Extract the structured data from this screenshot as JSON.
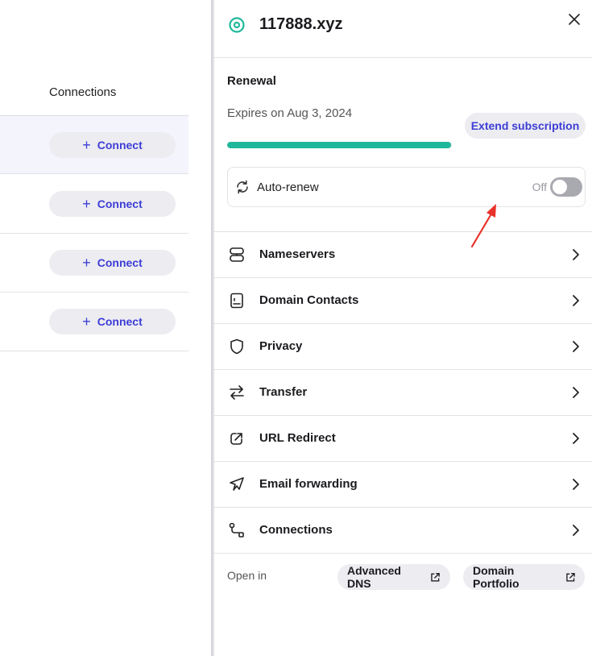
{
  "left_panel": {
    "column_header": "Connections",
    "rows": [
      {
        "connect_label": "Connect"
      },
      {
        "connect_label": "Connect"
      },
      {
        "connect_label": "Connect"
      },
      {
        "connect_label": "Connect"
      }
    ]
  },
  "drawer": {
    "domain": "117888.xyz",
    "renewal": {
      "title": "Renewal",
      "expires_text": "Expires on Aug 3, 2024",
      "extend_label": "Extend subscription",
      "progress_fraction": 0.995,
      "auto_renew_label": "Auto-renew",
      "auto_renew_state": "Off"
    },
    "menu": [
      {
        "label": "Nameservers",
        "icon": "server-icon"
      },
      {
        "label": "Domain Contacts",
        "icon": "contact-book-icon"
      },
      {
        "label": "Privacy",
        "icon": "shield-icon"
      },
      {
        "label": "Transfer",
        "icon": "transfer-arrows-icon"
      },
      {
        "label": "URL Redirect",
        "icon": "redirect-link-icon"
      },
      {
        "label": "Email forwarding",
        "icon": "email-forward-icon"
      },
      {
        "label": "Connections",
        "icon": "connections-icon"
      }
    ],
    "open_in": {
      "label": "Open in",
      "advanced_dns": "Advanced DNS",
      "domain_portfolio": "Domain Portfolio"
    }
  },
  "colors": {
    "accent_blue": "#3d3dd6",
    "progress_teal": "#1fb89a",
    "annotation_red": "#e8322a"
  }
}
